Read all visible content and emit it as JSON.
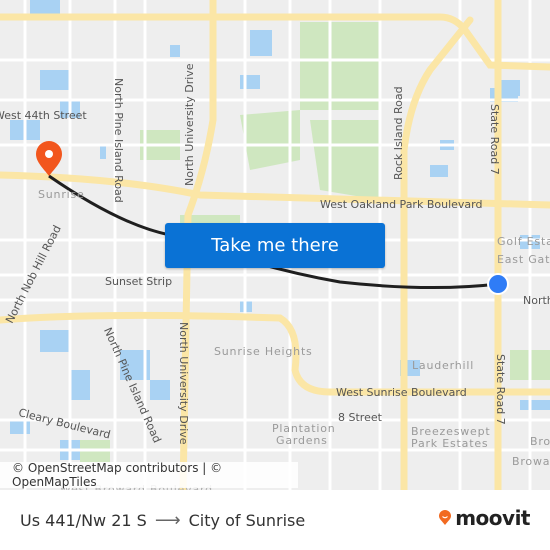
{
  "map": {
    "colors": {
      "background": "#eeeeee",
      "major_road": "#fbe6a6",
      "minor_road": "#ffffff",
      "water": "#a9d2f3",
      "park": "#cfe7c0",
      "route": "#1f1f1f",
      "origin_marker": "#2f7cf6",
      "destination_marker": "#f2561d"
    },
    "labels": {
      "west_44th": "West 44th Street",
      "north_pine_island_top": "North Pine Island Road",
      "north_university_top": "North University Drive",
      "rock_island": "Rock Island Road",
      "state_road_7_top": "State Road 7",
      "oakland_park": "West Oakland Park Boulevard",
      "sunrise": "Sunrise",
      "golf_estates": "Golf Estates",
      "east_gate": "East Gate",
      "north_right": "North",
      "north_nob_hill": "North Nob Hill Road",
      "sunset_strip": "Sunset Strip",
      "north_pine_island_bottom": "North Pine Island Road",
      "north_university_bottom": "North University Drive",
      "sunrise_heights": "Sunrise Heights",
      "lauderhill": "Lauderhill",
      "west_sunrise": "West Sunrise Boulevard",
      "state_road_7_bottom": "State Road 7",
      "cleary": "Cleary Boulevard",
      "eight_street": "8 Street",
      "plantation_gardens_1": "Plantation",
      "plantation_gardens_2": "Gardens",
      "breezeswept_1": "Breezeswept",
      "breezeswept_2": "Park Estates",
      "brow": "Brow",
      "broward": "Broward",
      "west_broward": "West Broward Boulevard"
    },
    "origin_marker_icon": "origin-dot-icon",
    "destination_marker_icon": "map-pin-icon"
  },
  "cta": {
    "label": "Take me there"
  },
  "attribution": "© OpenStreetMap contributors | © OpenMapTiles",
  "footer": {
    "origin": "Us 441/Nw 21 S",
    "arrow": "⟶",
    "destination": "City of Sunrise",
    "brand": "moovit",
    "brand_color": "#f26a21"
  }
}
